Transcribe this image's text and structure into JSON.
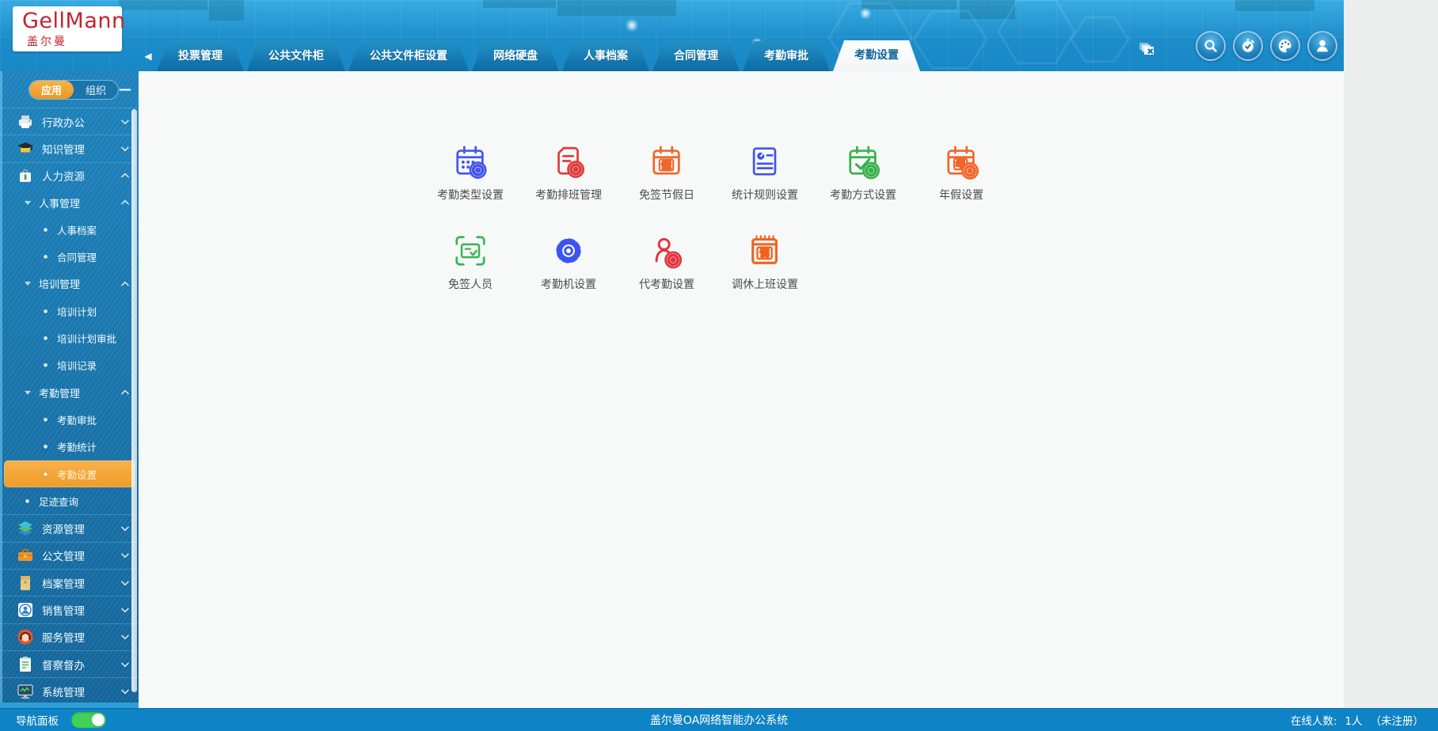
{
  "logo": {
    "title": "GellMann",
    "subtitle": "盖尔曼"
  },
  "header": {
    "tabs": [
      {
        "label": "投票管理"
      },
      {
        "label": "公共文件柜"
      },
      {
        "label": "公共文件柜设置"
      },
      {
        "label": "网络硬盘"
      },
      {
        "label": "人事档案"
      },
      {
        "label": "合同管理"
      },
      {
        "label": "考勤审批"
      },
      {
        "label": "考勤设置",
        "active": true
      }
    ],
    "actions": [
      {
        "name": "search-icon"
      },
      {
        "name": "timer-icon"
      },
      {
        "name": "theme-icon"
      },
      {
        "name": "user-icon"
      }
    ],
    "close_tabs_icon": "close-tabs-icon"
  },
  "sidebar": {
    "mode_app": "应用",
    "mode_org": "组织",
    "collapse_glyph": "—",
    "items": [
      {
        "label": "行政办公",
        "kind": "app",
        "icon": "printer-icon",
        "chevron": "down"
      },
      {
        "label": "知识管理",
        "kind": "app",
        "icon": "graduation-cap-icon",
        "chevron": "down"
      },
      {
        "label": "人力资源",
        "kind": "app",
        "icon": "hr-bag-icon",
        "chevron": "up"
      },
      {
        "label": "人事管理",
        "kind": "section",
        "chevron": "up"
      },
      {
        "label": "人事档案",
        "kind": "item"
      },
      {
        "label": "合同管理",
        "kind": "item"
      },
      {
        "label": "培训管理",
        "kind": "section",
        "chevron": "up"
      },
      {
        "label": "培训计划",
        "kind": "item"
      },
      {
        "label": "培训计划审批",
        "kind": "item"
      },
      {
        "label": "培训记录",
        "kind": "item"
      },
      {
        "label": "考勤管理",
        "kind": "section",
        "chevron": "up"
      },
      {
        "label": "考勤审批",
        "kind": "item"
      },
      {
        "label": "考勤统计",
        "kind": "item"
      },
      {
        "label": "考勤设置",
        "kind": "item",
        "active": true
      },
      {
        "label": "足迹查询",
        "kind": "item",
        "indent": 1
      },
      {
        "label": "资源管理",
        "kind": "app",
        "icon": "layers-icon",
        "chevron": "down"
      },
      {
        "label": "公文管理",
        "kind": "app",
        "icon": "briefcase-icon",
        "chevron": "down"
      },
      {
        "label": "档案管理",
        "kind": "app",
        "icon": "archive-icon",
        "chevron": "down"
      },
      {
        "label": "销售管理",
        "kind": "app",
        "icon": "sales-person-icon",
        "chevron": "down"
      },
      {
        "label": "服务管理",
        "kind": "app",
        "icon": "headset-icon",
        "chevron": "down"
      },
      {
        "label": "督察督办",
        "kind": "app",
        "icon": "clipboard-icon",
        "chevron": "down"
      },
      {
        "label": "系统管理",
        "kind": "app",
        "icon": "monitor-icon",
        "chevron": "down"
      }
    ]
  },
  "content": {
    "rows": [
      {
        "items": [
          {
            "label": "考勤类型设置",
            "icon": "calendar-gear-icon",
            "color": "#4254f0"
          },
          {
            "label": "考勤排班管理",
            "icon": "doc-gear-icon",
            "color": "#e23a3a"
          },
          {
            "label": "免签节假日",
            "icon": "calendar-holiday-icon",
            "color": "#f2652a",
            "glyph": "假"
          },
          {
            "label": "统计规则设置",
            "icon": "doc-pie-icon",
            "color": "#4254f0"
          },
          {
            "label": "考勤方式设置",
            "icon": "calendar-check-gear-icon",
            "color": "#35b24a"
          },
          {
            "label": "年假设置",
            "icon": "calendar-year-gear-icon",
            "color": "#f2652a",
            "glyph": "年"
          }
        ]
      },
      {
        "items": [
          {
            "label": "免签人员",
            "icon": "scan-id-icon",
            "color": "#38b457"
          },
          {
            "label": "考勤机设置",
            "icon": "machine-gear-icon",
            "color": "#3b55f2"
          },
          {
            "label": "代考勤设置",
            "icon": "person-gear-icon",
            "color": "#e2333f"
          },
          {
            "label": "调休上班设置",
            "icon": "calendar-swap-icon",
            "color": "#f2611f",
            "glyph": "调"
          }
        ]
      }
    ]
  },
  "footer": {
    "nav_label": "导航面板",
    "toggle_on": true,
    "title": "盖尔曼OA网络智能办公系统",
    "online_label": "在线人数:",
    "online_count": "1人",
    "online_status": "（未注册）"
  }
}
